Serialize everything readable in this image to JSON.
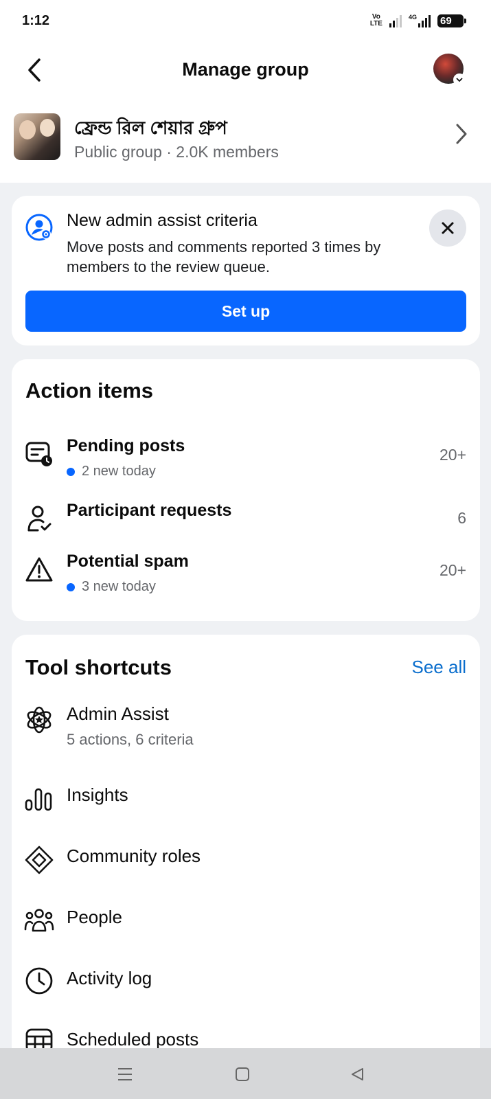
{
  "status_bar": {
    "time": "1:12",
    "volte_top": "Vo",
    "volte_bottom": "LTE",
    "network_label": "4G",
    "battery": "69"
  },
  "header": {
    "title": "Manage group",
    "back_icon": "chevron-left-icon",
    "profile_icon": "avatar"
  },
  "group": {
    "name": "ফ্রেন্ড রিল শেয়ার গ্রুপ",
    "meta": "Public group · 2.0K members"
  },
  "assist_card": {
    "title": "New admin assist criteria",
    "description": "Move posts and comments reported 3 times by members to the review queue.",
    "button_label": "Set up",
    "accent_color": "#0866ff"
  },
  "action_items": {
    "title": "Action items",
    "items": [
      {
        "label": "Pending posts",
        "sub": "2 new today",
        "count": "20+",
        "icon": "pending-posts-icon"
      },
      {
        "label": "Participant requests",
        "sub": "",
        "count": "6",
        "icon": "participant-requests-icon"
      },
      {
        "label": "Potential spam",
        "sub": "3 new today",
        "count": "20+",
        "icon": "warning-icon"
      }
    ]
  },
  "tool_shortcuts": {
    "title": "Tool shortcuts",
    "see_all": "See all",
    "items": [
      {
        "label": "Admin Assist",
        "sub": "5 actions, 6 criteria",
        "icon": "admin-assist-icon"
      },
      {
        "label": "Insights",
        "sub": "",
        "icon": "insights-icon"
      },
      {
        "label": "Community roles",
        "sub": "",
        "icon": "community-roles-icon"
      },
      {
        "label": "People",
        "sub": "",
        "icon": "people-icon"
      },
      {
        "label": "Activity log",
        "sub": "",
        "icon": "clock-icon"
      },
      {
        "label": "Scheduled posts",
        "sub": "",
        "icon": "calendar-icon"
      }
    ]
  },
  "nav_bar": {
    "menu_icon": "menu-icon",
    "home_icon": "home-icon",
    "back_icon": "back-triangle-icon"
  }
}
